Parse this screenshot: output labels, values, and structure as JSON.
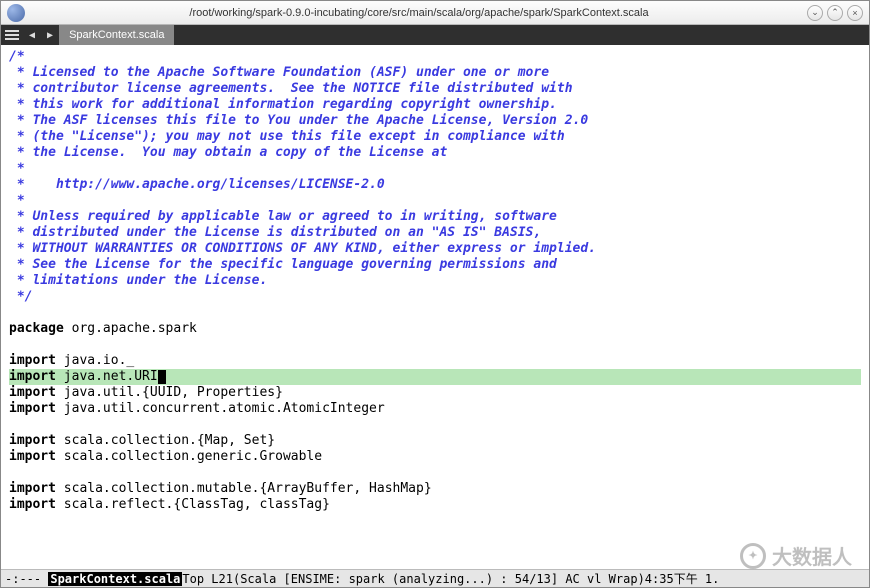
{
  "window": {
    "title": "/root/working/spark-0.9.0-incubating/core/src/main/scala/org/apache/spark/SparkContext.scala",
    "buttons": {
      "min": "⌄",
      "max": "⌃",
      "close": "×"
    }
  },
  "tabbar": {
    "active_tab": "SparkContext.scala"
  },
  "code": {
    "comment_lines": [
      "/*",
      " * Licensed to the Apache Software Foundation (ASF) under one or more",
      " * contributor license agreements.  See the NOTICE file distributed with",
      " * this work for additional information regarding copyright ownership.",
      " * The ASF licenses this file to You under the Apache License, Version 2.0",
      " * (the \"License\"); you may not use this file except in compliance with",
      " * the License.  You may obtain a copy of the License at",
      " *",
      " *    http://www.apache.org/licenses/LICENSE-2.0",
      " *",
      " * Unless required by applicable law or agreed to in writing, software",
      " * distributed under the License is distributed on an \"AS IS\" BASIS,",
      " * WITHOUT WARRANTIES OR CONDITIONS OF ANY KIND, either express or implied.",
      " * See the License for the specific language governing permissions and",
      " * limitations under the License.",
      " */"
    ],
    "package_kw": "package",
    "package_name": " org.apache.spark",
    "import_kw": "import",
    "imports_a": [
      " java.io._"
    ],
    "cursor_import": " java.net.URI",
    "imports_b": [
      " java.util.{UUID, Properties}",
      " java.util.concurrent.atomic.AtomicInteger"
    ],
    "imports_c": [
      " scala.collection.{Map, Set}",
      " scala.collection.generic.Growable"
    ],
    "imports_d": [
      " scala.collection.mutable.{ArrayBuffer, HashMap}",
      " scala.reflect.{ClassTag, classTag}"
    ]
  },
  "statusbar": {
    "left": "-:---",
    "buffer": "SparkContext.scala",
    "pos": "   Top L21    ",
    "mode": "(Scala [ENSIME: spark (analyzing...) : 54/13] AC vl Wrap)",
    "right": " 4:35下午 1."
  },
  "watermark": {
    "text": "大数据人"
  }
}
